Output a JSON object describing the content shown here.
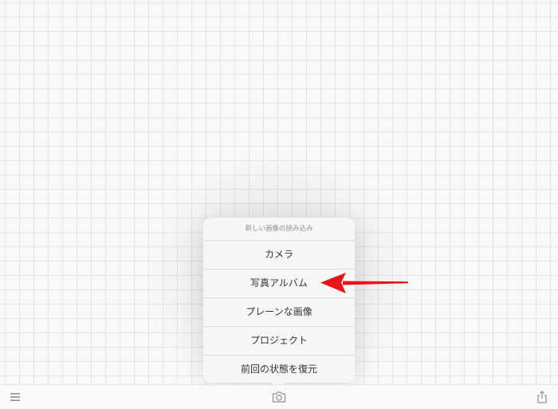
{
  "popover": {
    "title": "新しい画像の読み込み",
    "items": [
      {
        "id": "camera",
        "label": "カメラ"
      },
      {
        "id": "photo-album",
        "label": "写真アルバム"
      },
      {
        "id": "plain-image",
        "label": "プレーンな画像"
      },
      {
        "id": "project",
        "label": "プロジェクト"
      },
      {
        "id": "restore-previous",
        "label": "前回の状態を復元"
      }
    ]
  },
  "toolbar": {
    "left_icon": "hamburger-menu-icon",
    "center_icon": "camera-icon",
    "right_icon": "share-icon"
  },
  "annotation": {
    "arrow_color": "#e8141a",
    "points_to": "photo-album"
  },
  "colors": {
    "grid_line": "#e4e4e4",
    "background": "#f9f9f9",
    "popover_bg": "#f7f7f7",
    "icon_gray": "#8e8e93"
  }
}
